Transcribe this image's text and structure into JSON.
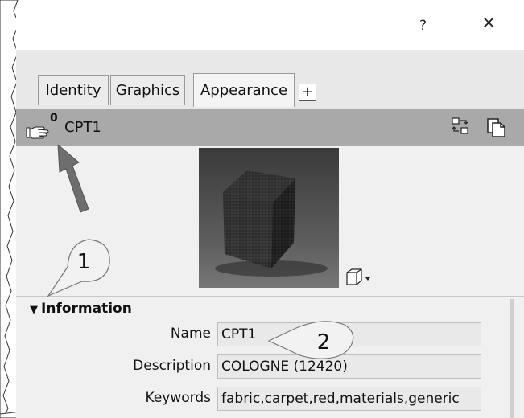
{
  "titlebar": {
    "help_label": "?",
    "close_label": "×"
  },
  "tabs": [
    {
      "label": "Identity",
      "active": false
    },
    {
      "label": "Graphics",
      "active": false
    },
    {
      "label": "Appearance",
      "active": true
    }
  ],
  "add_tab_label": "+",
  "asset_header": {
    "count": "0",
    "name": "CPT1"
  },
  "information": {
    "heading": "Information",
    "fields": [
      {
        "label": "Name",
        "value": "CPT1"
      },
      {
        "label": "Description",
        "value": "COLOGNE (12420)"
      },
      {
        "label": "Keywords",
        "value": "fabric,carpet,red,materials,generic"
      }
    ]
  },
  "callouts": [
    {
      "number": "1"
    },
    {
      "number": "2"
    }
  ],
  "colors": {
    "header_bg": "#a9a9a9",
    "arrow": "#6e6e6e",
    "callout_fill": "#f2f2f2"
  }
}
